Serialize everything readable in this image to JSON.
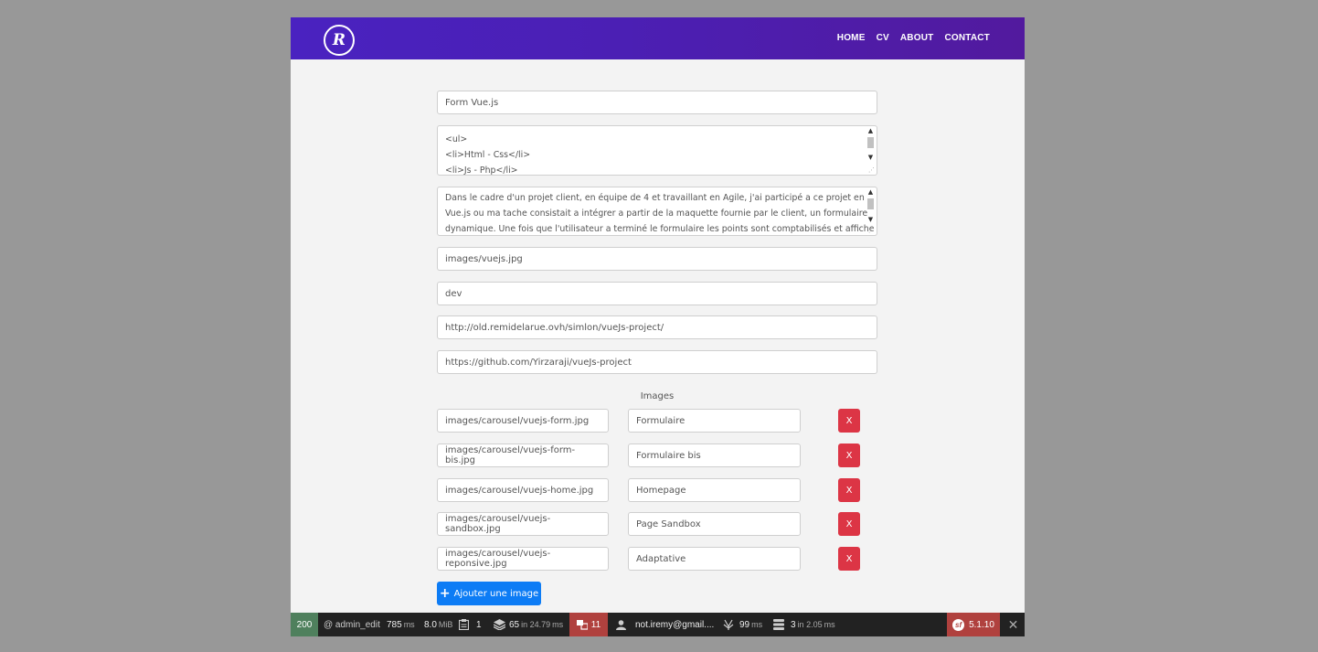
{
  "navbar": {
    "logo_text": "R",
    "links": [
      "HOME",
      "CV",
      "ABOUT",
      "CONTACT"
    ]
  },
  "form": {
    "title": "Form Vue.js",
    "skills_lines": [
      "<ul>",
      "<li>Html - Css</li>",
      "<li>Js - Php</li>"
    ],
    "description_lines": [
      "Dans le cadre d'un projet client, en équipe de 4 et travaillant en Agile, j'ai participé a ce projet en",
      "Vue.js ou ma tache consistait a intégrer a partir de la maquette fournie par le client, un formulaire",
      "dynamique. Une fois que l'utilisateur a terminé le formulaire les points sont comptabilisés et affiche"
    ],
    "image": "images/vuejs.jpg",
    "category": "dev",
    "demo_url": "http://old.remidelarue.ovh/simlon/vueJs-project/",
    "github_url": "https://github.com/Yirzaraji/vueJs-project"
  },
  "images_section": {
    "heading": "Images",
    "rows": [
      {
        "path": "images/carousel/vuejs-form.jpg",
        "caption": "Formulaire",
        "delete_label": "X"
      },
      {
        "path": "images/carousel/vuejs-form-bis.jpg",
        "caption": "Formulaire bis",
        "delete_label": "X"
      },
      {
        "path": "images/carousel/vuejs-home.jpg",
        "caption": "Homepage",
        "delete_label": "X"
      },
      {
        "path": "images/carousel/vuejs-sandbox.jpg",
        "caption": "Page Sandbox",
        "delete_label": "X"
      },
      {
        "path": "images/carousel/vuejs-reponsive.jpg",
        "caption": "Adaptative",
        "delete_label": "X"
      }
    ],
    "add_button_label": "Ajouter une image"
  },
  "debug_toolbar": {
    "status_code": "200",
    "route": "@ admin_edit",
    "time": "785",
    "time_unit": "ms",
    "memory": "8.0",
    "memory_unit": "MiB",
    "forms_count": "1",
    "templates": "65",
    "templates_in": "in 24.79",
    "templates_unit": "ms",
    "logs_count": "11",
    "user": "not.iremy@gmail....",
    "events_time": "99",
    "events_unit": "ms",
    "db_queries": "3",
    "db_in": "in 2.05",
    "db_unit": "ms",
    "version": "5.1.10",
    "colors": {
      "status": "#4f805d",
      "error": "#b0413e",
      "bar": "#222222"
    }
  }
}
